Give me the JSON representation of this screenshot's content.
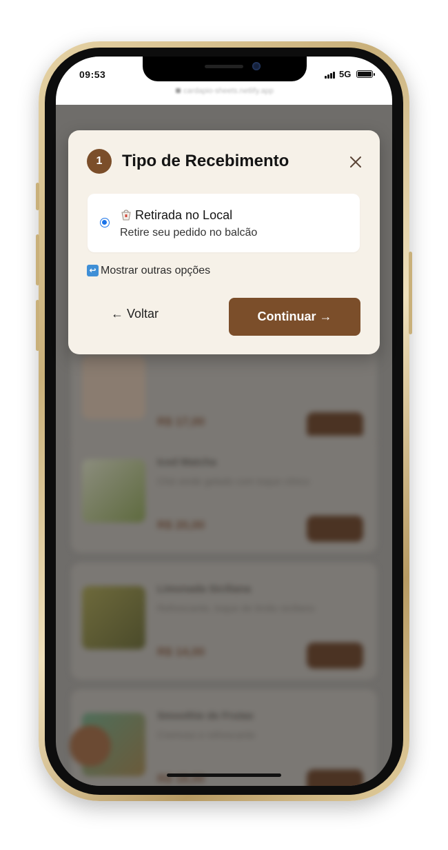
{
  "status_bar": {
    "time": "09:53",
    "network": "5G",
    "url": "cardapio-sheets.netlify.app"
  },
  "modal": {
    "step_number": "1",
    "title": "Tipo de Recebimento",
    "option": {
      "title": "Retirada no Local",
      "subtitle": "Retire seu pedido no balcão",
      "selected": true,
      "icon": "takeout-box-icon"
    },
    "more_options_label": "Mostrar outras opções",
    "back_label": "← Voltar",
    "continue_label": "Continuar →"
  },
  "colors": {
    "accent": "#7b4e2a",
    "modal_bg": "#f6f1e8",
    "radio": "#1a73e8"
  },
  "background_items": [
    {
      "name": "",
      "description": "",
      "price": "R$ 17,00"
    },
    {
      "name": "Iced Matcha",
      "description": "Chá verde gelado com toque cítrico",
      "price": "R$ 20,00"
    },
    {
      "name": "Limonada Siciliana",
      "description": "Refrescante, toque de limão siciliano",
      "price": "R$ 14,00"
    },
    {
      "name": "Smoothie de Frutas",
      "description": "Cremoso e refrescante",
      "price": "R$ 18,00"
    }
  ]
}
